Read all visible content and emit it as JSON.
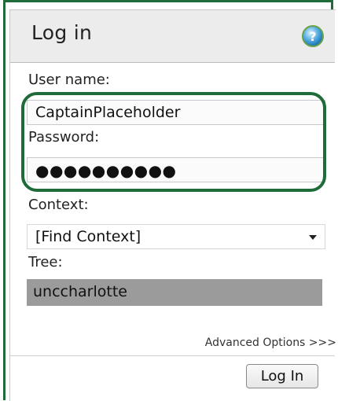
{
  "dialog": {
    "title": "Log in",
    "help_icon": "help-icon"
  },
  "username": {
    "label": "User name:",
    "value": "CaptainPlaceholder"
  },
  "password": {
    "label": "Password:",
    "value": "●●●●●●●●●●"
  },
  "context": {
    "label": "Context:",
    "selected": "[Find Context]"
  },
  "tree": {
    "label": "Tree:",
    "value": "unccharlotte"
  },
  "advanced_options_label": "Advanced Options >>>",
  "login_button_label": "Log In",
  "colors": {
    "highlight": "#1f6b3a",
    "header_bg": "#ececec",
    "tree_field_bg": "#9b9b9b"
  }
}
